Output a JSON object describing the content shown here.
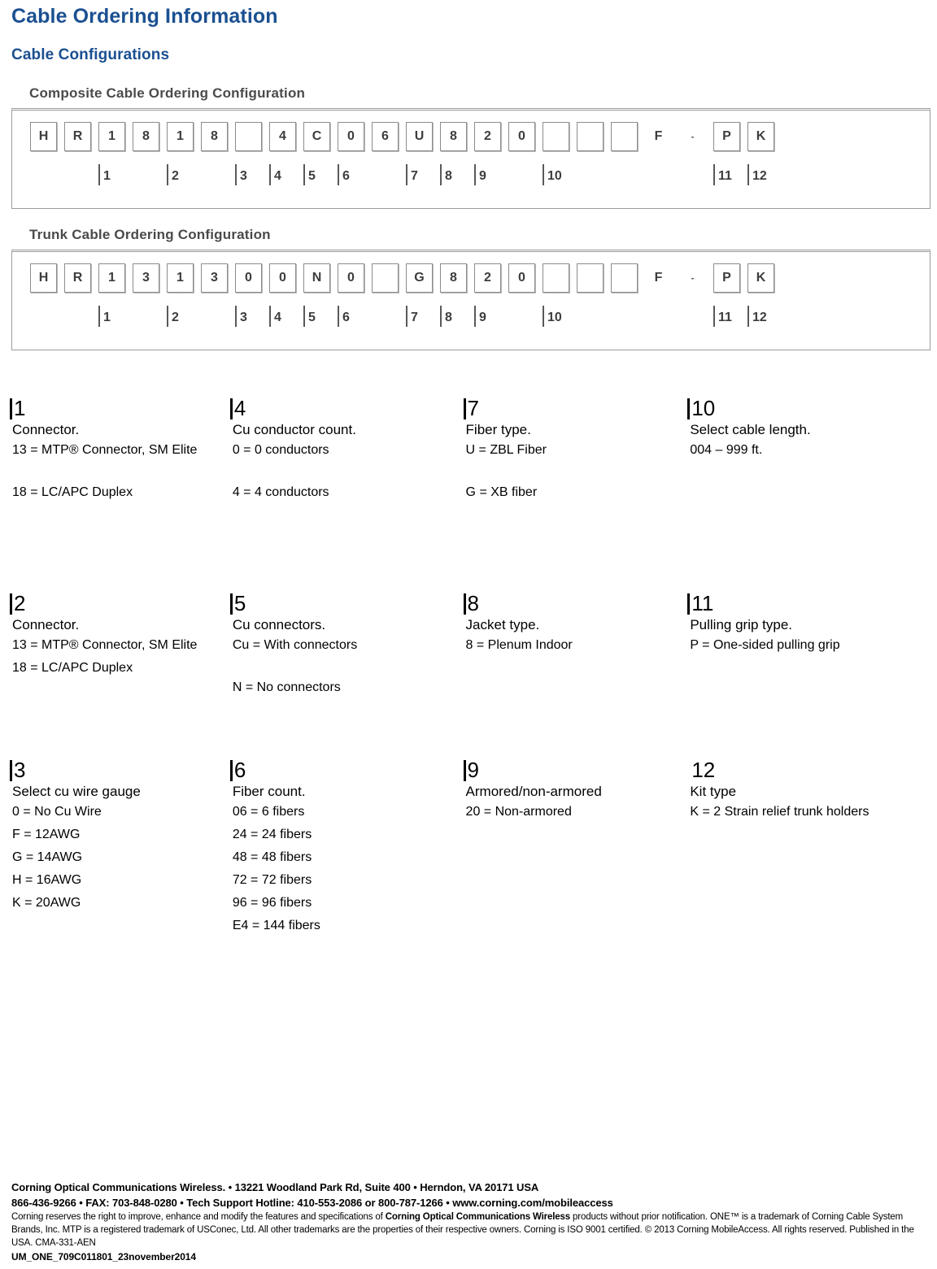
{
  "document": {
    "title": "Cable Ordering Information",
    "subtitle": "Cable Configurations"
  },
  "configurations": [
    {
      "caption": "Composite Cable Ordering Configuration",
      "cells": [
        "H",
        "R",
        "1",
        "8",
        "1",
        "8",
        "",
        "4",
        "C",
        "0",
        "6",
        "U",
        "8",
        "2",
        "0",
        "",
        "",
        "",
        "F",
        "-",
        "P",
        "K"
      ],
      "blank_indexes": [
        6,
        15,
        16,
        17
      ],
      "plain_indexes": [
        18,
        19
      ],
      "ticks": [
        {
          "label": "1",
          "cell": 2
        },
        {
          "label": "2",
          "cell": 4
        },
        {
          "label": "3",
          "cell": 6
        },
        {
          "label": "4",
          "cell": 7
        },
        {
          "label": "5",
          "cell": 8
        },
        {
          "label": "6",
          "cell": 9
        },
        {
          "label": "7",
          "cell": 11
        },
        {
          "label": "8",
          "cell": 12
        },
        {
          "label": "9",
          "cell": 13
        },
        {
          "label": "10",
          "cell": 15
        },
        {
          "label": "11",
          "cell": 20
        },
        {
          "label": "12",
          "cell": 21
        }
      ]
    },
    {
      "caption": "Trunk Cable Ordering Configuration",
      "cells": [
        "H",
        "R",
        "1",
        "3",
        "1",
        "3",
        "0",
        "0",
        "N",
        "0",
        "",
        "G",
        "8",
        "2",
        "0",
        "",
        "",
        "",
        "F",
        "-",
        "P",
        "K"
      ],
      "blank_indexes": [
        10,
        15,
        16,
        17
      ],
      "plain_indexes": [
        18,
        19
      ],
      "ticks": [
        {
          "label": "1",
          "cell": 2
        },
        {
          "label": "2",
          "cell": 4
        },
        {
          "label": "3",
          "cell": 6
        },
        {
          "label": "4",
          "cell": 7
        },
        {
          "label": "5",
          "cell": 8
        },
        {
          "label": "6",
          "cell": 9
        },
        {
          "label": "7",
          "cell": 11
        },
        {
          "label": "8",
          "cell": 12
        },
        {
          "label": "9",
          "cell": 13
        },
        {
          "label": "10",
          "cell": 15
        },
        {
          "label": "11",
          "cell": 20
        },
        {
          "label": "12",
          "cell": 21
        }
      ]
    }
  ],
  "legend": {
    "rows": [
      [
        {
          "index": "1",
          "has_bar": true,
          "description": "Connector.",
          "items": [
            "13 = MTP® Connector, SM Elite",
            "18 = LC/APC Duplex"
          ],
          "item_gaps": [
            true,
            false
          ]
        },
        {
          "index": "4",
          "has_bar": true,
          "description": "Cu conductor count.",
          "items": [
            "0 = 0 conductors",
            "4 = 4 conductors"
          ],
          "item_gaps": [
            true,
            false
          ]
        },
        {
          "index": "7",
          "has_bar": true,
          "description": "Fiber type.",
          "items": [
            "U = ZBL Fiber",
            "G = XB fiber"
          ],
          "item_gaps": [
            true,
            false
          ]
        },
        {
          "index": "10",
          "has_bar": true,
          "description": "Select cable length.",
          "items": [
            "004 – 999 ft."
          ],
          "item_gaps": [
            false
          ]
        }
      ],
      [
        {
          "index": "2",
          "has_bar": true,
          "description": "Connector.",
          "items": [
            "13 = MTP® Connector, SM Elite",
            "18 = LC/APC Duplex"
          ],
          "item_gaps": [
            false,
            false
          ]
        },
        {
          "index": "5",
          "has_bar": true,
          "description": "Cu connectors.",
          "items": [
            "Cu = With connectors",
            "N = No connectors"
          ],
          "item_gaps": [
            true,
            false
          ]
        },
        {
          "index": "8",
          "has_bar": true,
          "description": "Jacket type.",
          "items": [
            "8 = Plenum Indoor"
          ],
          "item_gaps": [
            false
          ]
        },
        {
          "index": "11",
          "has_bar": true,
          "description": "Pulling grip type.",
          "items": [
            "P = One-sided pulling grip"
          ],
          "item_gaps": [
            false
          ]
        }
      ],
      [
        {
          "index": "3",
          "has_bar": true,
          "description": "Select cu wire gauge",
          "items": [
            "0 = No Cu Wire",
            "F = 12AWG",
            "G = 14AWG",
            "H = 16AWG",
            "K = 20AWG"
          ],
          "item_gaps": [
            false,
            false,
            false,
            false,
            false
          ]
        },
        {
          "index": "6",
          "has_bar": true,
          "description": "Fiber count.",
          "items": [
            "06 = 6 fibers",
            "24 = 24 fibers",
            "48 = 48 fibers",
            "72 = 72 fibers",
            "96 = 96 fibers",
            "E4 = 144 fibers"
          ],
          "item_gaps": [
            false,
            false,
            false,
            false,
            false,
            false
          ]
        },
        {
          "index": "9",
          "has_bar": true,
          "description": "Armored/non-armored",
          "items": [
            "20 = Non-armored"
          ],
          "item_gaps": [
            false
          ]
        },
        {
          "index": "12",
          "has_bar": false,
          "description": "Kit   type",
          "items": [
            "K = 2 Strain relief trunk holders"
          ],
          "item_gaps": [
            false
          ]
        }
      ]
    ]
  },
  "footer": {
    "address_line": "Corning Optical Communications Wireless. • 13221 Woodland Park Rd, Suite 400 • Herndon, VA 20171 USA",
    "contact_line": "866-436-9266 • FAX: 703-848-0280 • Tech Support Hotline: 410-553-2086 or 800-787-1266 • www.corning.com/mobileaccess",
    "disclaimer_pre": "Corning reserves the right to improve, enhance and modify the features and specifications of ",
    "disclaimer_bold": "Corning Optical Communications Wireless",
    "disclaimer_post": " products without prior notification. ONE™ is a trademark of Corning Cable System Brands, Inc. MTP is a registered trademark of USConec, Ltd. All other trademarks are the properties of their respective owners. Corning is ISO 9001 certified. © 2013 Corning MobileAccess. All rights reserved. Published in the USA. CMA-331-AEN",
    "doc_code": "UM_ONE_709C011801_23november2014"
  },
  "colors": {
    "heading_blue": "#1b5091",
    "cell_border": "#8c8c8c",
    "frame_border": "#9b9b9b",
    "caption_gray": "#4a4a4a"
  }
}
